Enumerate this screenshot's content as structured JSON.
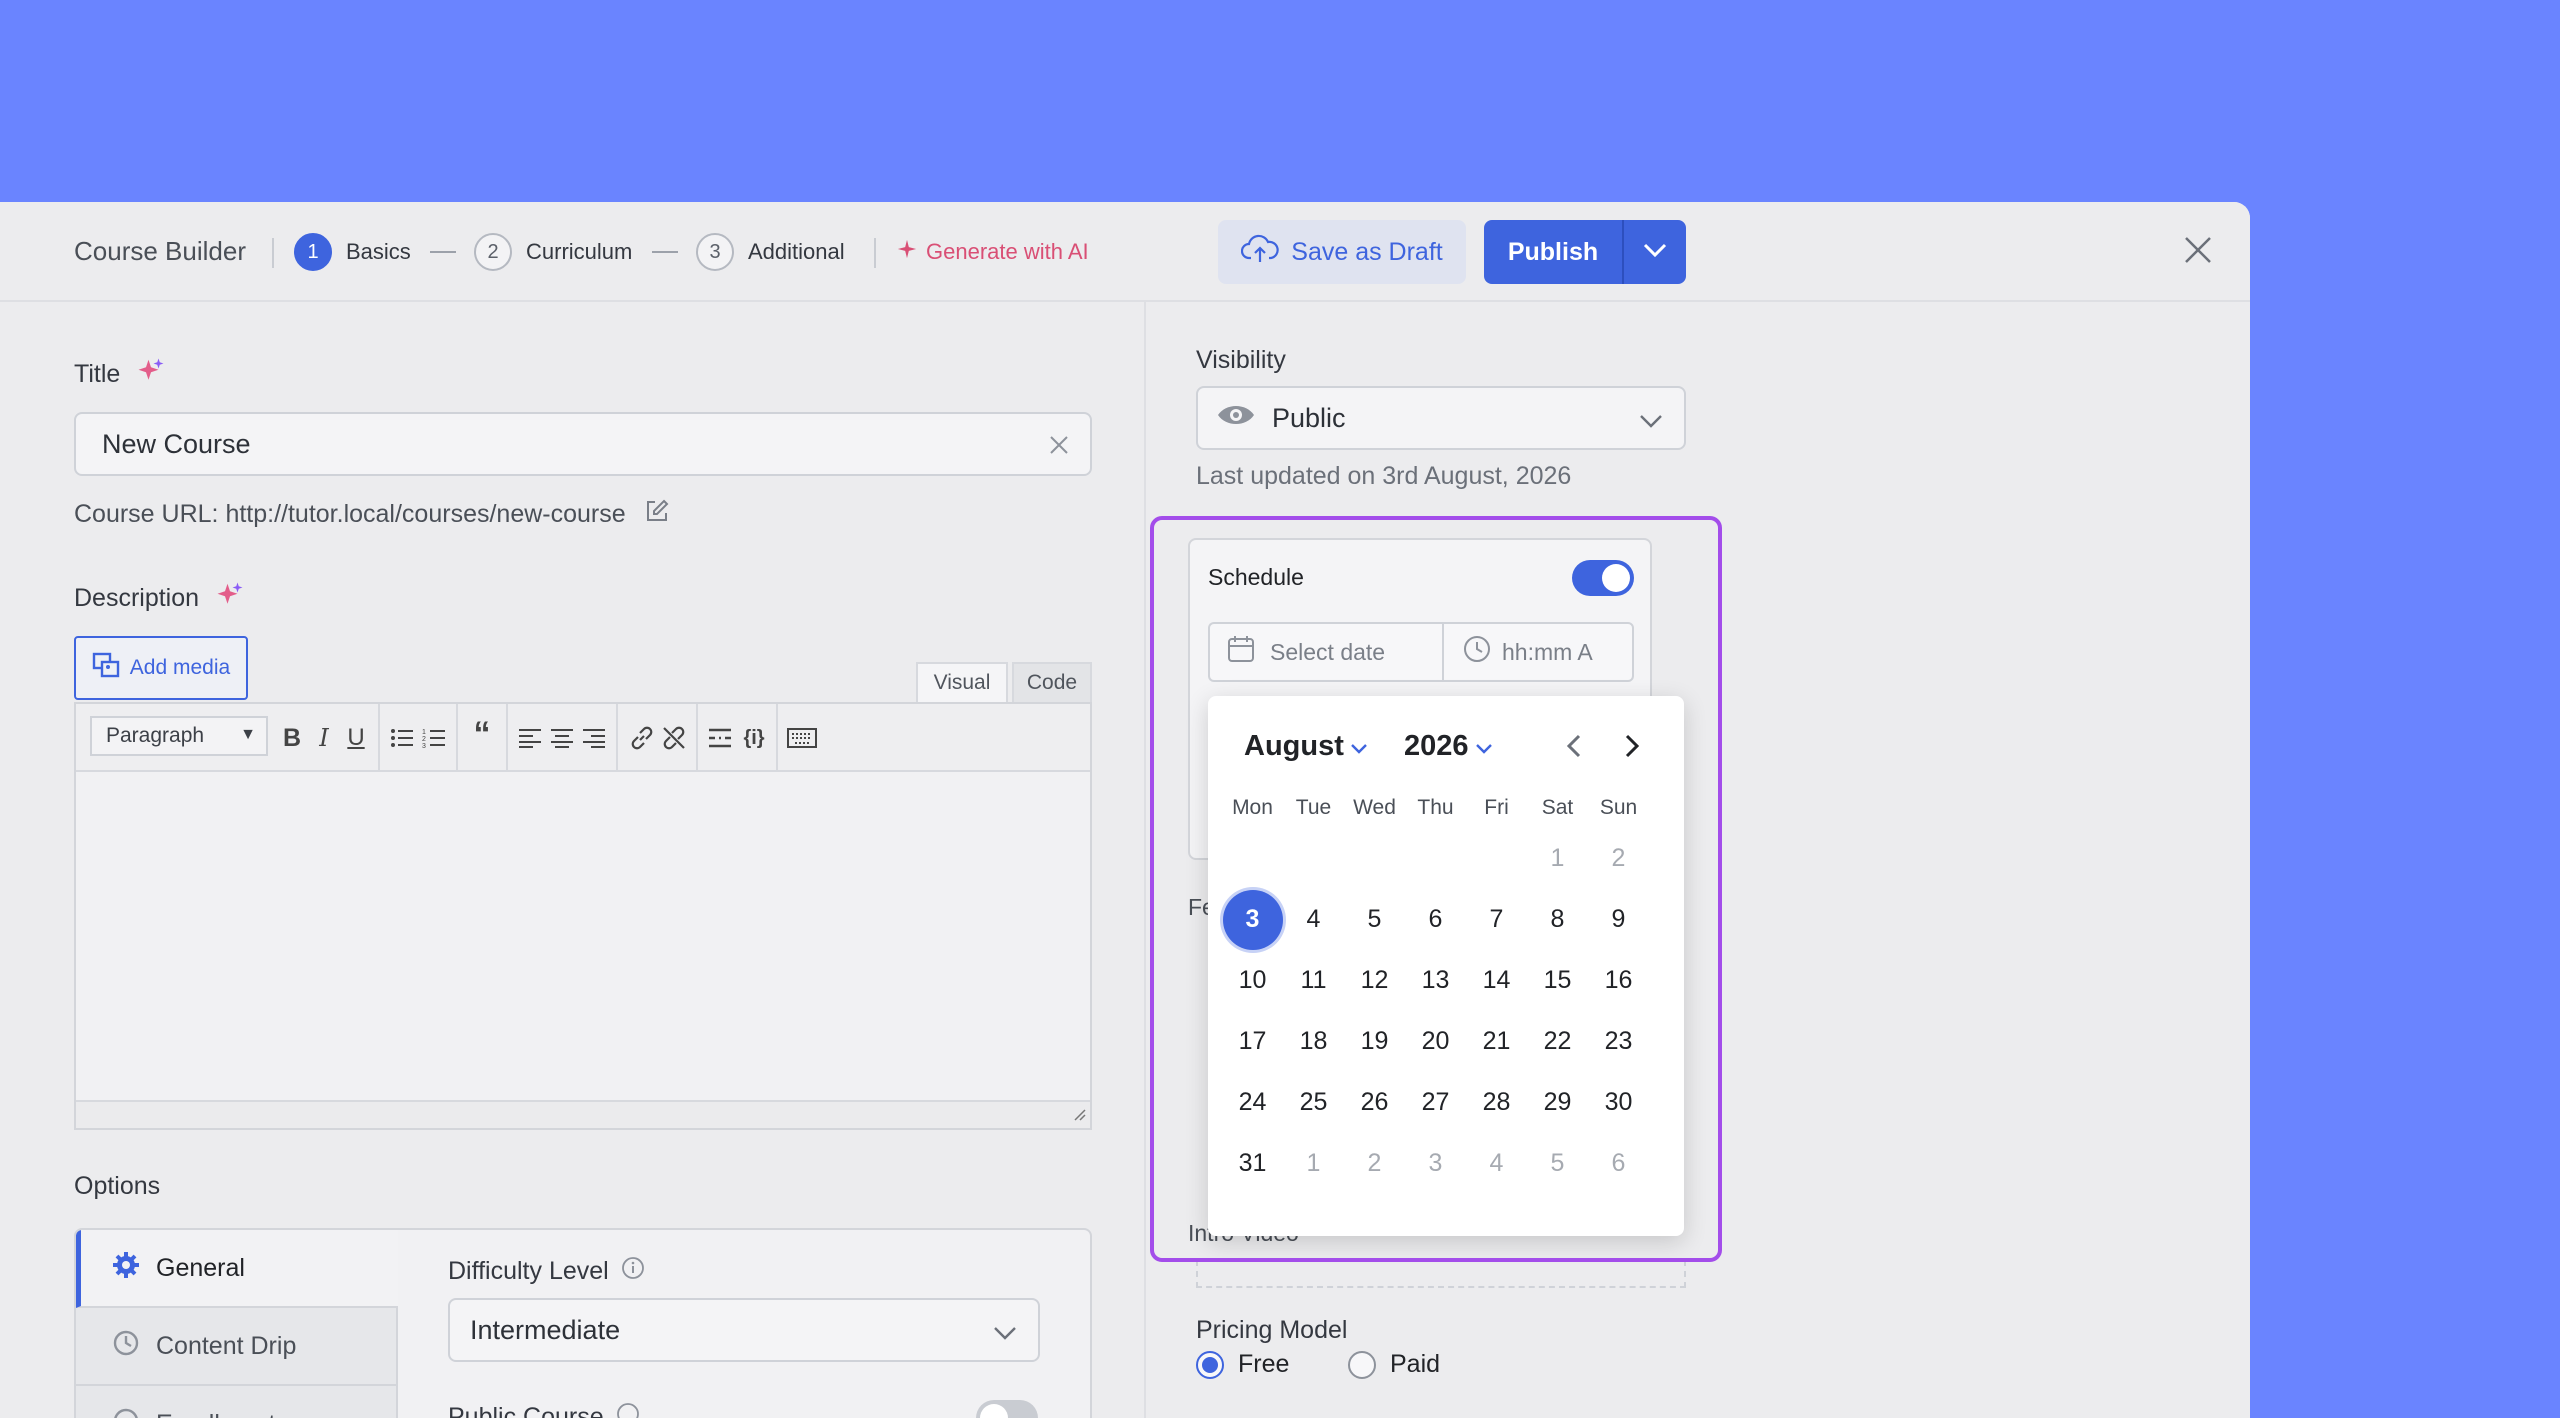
{
  "header": {
    "title": "Course Builder",
    "steps": [
      {
        "num": "1",
        "label": "Basics"
      },
      {
        "num": "2",
        "label": "Curriculum"
      },
      {
        "num": "3",
        "label": "Additional"
      }
    ],
    "ai_label": "Generate with AI",
    "save_draft_label": "Save as Draft",
    "publish_label": "Publish"
  },
  "basics": {
    "title_label": "Title",
    "title_value": "New Course",
    "course_url": "Course URL: http://tutor.local/courses/new-course",
    "description_label": "Description",
    "add_media_label": "Add media",
    "tab_visual": "Visual",
    "tab_code": "Code",
    "paragraph_select": "Paragraph"
  },
  "options": {
    "label": "Options",
    "items": [
      {
        "label": "General"
      },
      {
        "label": "Content Drip"
      },
      {
        "label": "Enrollment"
      }
    ],
    "difficulty_label": "Difficulty Level",
    "difficulty_value": "Intermediate",
    "public_course_label": "Public Course"
  },
  "sidebar": {
    "visibility_label": "Visibility",
    "visibility_value": "Public",
    "last_updated": "Last updated on 3rd August, 2026",
    "schedule_label": "Schedule",
    "schedule_enabled": true,
    "date_placeholder": "Select date",
    "time_placeholder": "hh:mm A",
    "featured_partial": "Fe",
    "intro_video_label": "Intro Video",
    "pricing_label": "Pricing Model",
    "pricing_options": [
      {
        "label": "Free",
        "selected": true
      },
      {
        "label": "Paid",
        "selected": false
      }
    ]
  },
  "calendar": {
    "month": "August",
    "year": "2026",
    "weekdays": [
      "Mon",
      "Tue",
      "Wed",
      "Thu",
      "Fri",
      "Sat",
      "Sun"
    ],
    "weeks": [
      [
        "",
        "",
        "",
        "",
        "",
        "1",
        "2"
      ],
      [
        "3",
        "4",
        "5",
        "6",
        "7",
        "8",
        "9"
      ],
      [
        "10",
        "11",
        "12",
        "13",
        "14",
        "15",
        "16"
      ],
      [
        "17",
        "18",
        "19",
        "20",
        "21",
        "22",
        "23"
      ],
      [
        "24",
        "25",
        "26",
        "27",
        "28",
        "29",
        "30"
      ],
      [
        "31",
        "1",
        "2",
        "3",
        "4",
        "5",
        "6"
      ]
    ],
    "selected_day": "3",
    "accent_color": "#3e64de"
  },
  "colors": {
    "background": "#6a84ff",
    "accent": "#3e64de",
    "highlight_outline": "#a34dea",
    "ai_pink": "#d94f75"
  }
}
